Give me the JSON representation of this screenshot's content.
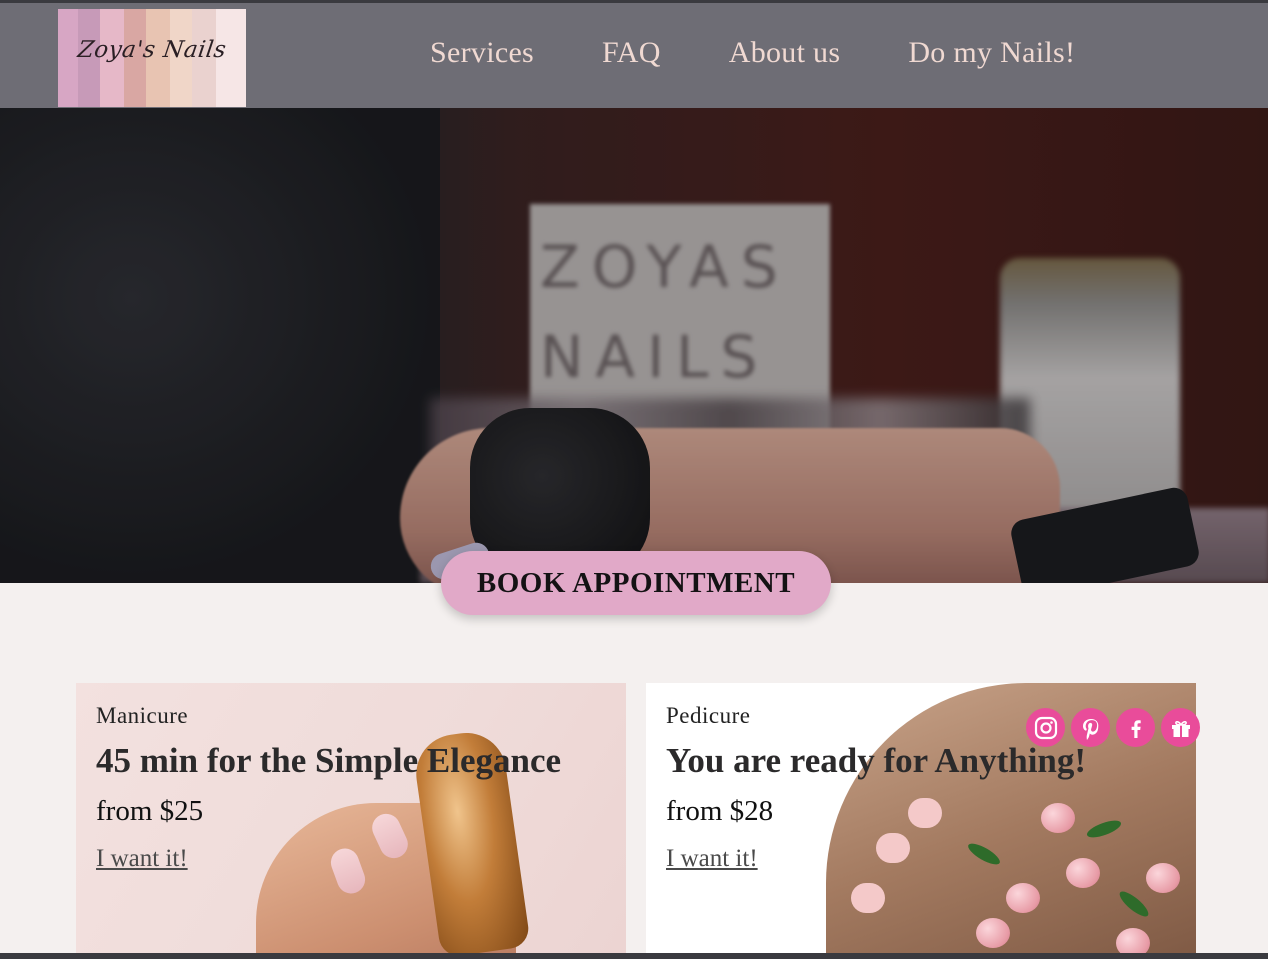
{
  "header": {
    "logo_text": "Zoya's Nails",
    "nav": [
      {
        "label": "Services"
      },
      {
        "label": "FAQ"
      },
      {
        "label": "About us"
      },
      {
        "label": "Do my Nails!"
      }
    ]
  },
  "hero": {
    "sign_text": "ZOYAS NAILS",
    "book_button": "BOOK APPOINTMENT"
  },
  "cards": [
    {
      "kicker": "Manicure",
      "title": "45 min for the Simple Elegance",
      "price": "from $25",
      "cta": "I want it!"
    },
    {
      "kicker": "Pedicure",
      "title": "You are ready for Anything!",
      "price": "from $28",
      "cta": "I want it!"
    }
  ],
  "social": [
    {
      "icon": "instagram-icon"
    },
    {
      "icon": "pinterest-icon"
    },
    {
      "icon": "facebook-icon"
    },
    {
      "icon": "gift-icon"
    }
  ],
  "colors": {
    "header_bg": "#6e6d75",
    "nav_text": "#f0d9d2",
    "book_button_bg": "#e1a9c8",
    "social_icon_bg": "#e94c9a",
    "page_bg": "#f4f0ef"
  }
}
